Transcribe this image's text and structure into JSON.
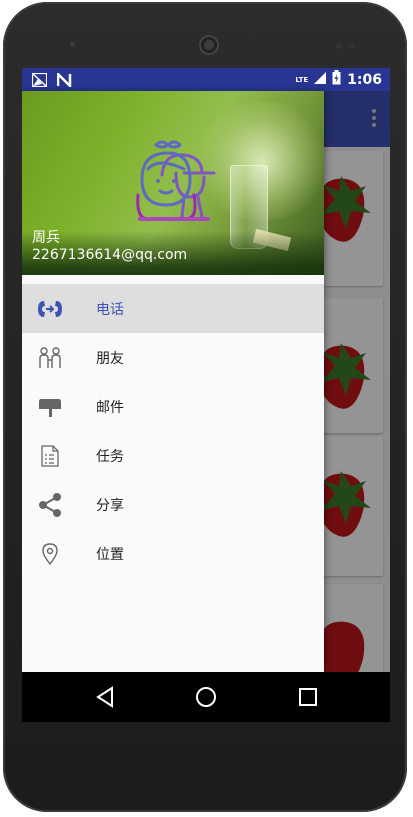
{
  "status_bar": {
    "time": "1:06",
    "network": "LTE",
    "colors": {
      "bar": "#283593"
    }
  },
  "app_bar": {
    "color": "#3f51b5",
    "overflow_icon": "more-vert-icon"
  },
  "drawer": {
    "header": {
      "name": "周兵",
      "email": "2267136614@qq.com",
      "avatar_icon": "kids-avatar-icon"
    },
    "items": [
      {
        "label": "电话",
        "icon": "call-transfer-icon",
        "selected": true
      },
      {
        "label": "朋友",
        "icon": "friends-icon",
        "selected": false
      },
      {
        "label": "邮件",
        "icon": "mailbox-icon",
        "selected": false
      },
      {
        "label": "任务",
        "icon": "task-list-icon",
        "selected": false
      },
      {
        "label": "分享",
        "icon": "share-icon",
        "selected": false
      },
      {
        "label": "位置",
        "icon": "location-icon",
        "selected": false
      }
    ],
    "accent_color": "#3f51b5"
  },
  "nav_bar": {
    "back": "back-icon",
    "home": "home-icon",
    "recents": "recents-icon"
  }
}
